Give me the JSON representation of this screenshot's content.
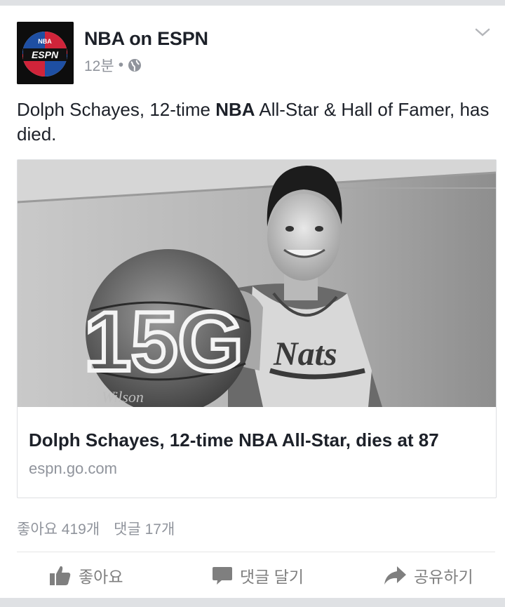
{
  "post": {
    "author": "NBA on ESPN",
    "time": "12분",
    "separator": "•",
    "text_before": "Dolph Schayes, 12-time ",
    "text_bold": "NBA",
    "text_after": " All-Star & Hall of Famer, has died."
  },
  "logo": {
    "top_text": "NBA",
    "bottom_text": "ESPN"
  },
  "link": {
    "title": "Dolph Schayes, 12-time NBA All-Star, dies at 87",
    "domain": "espn.go.com",
    "photo": {
      "ball_text": "15G",
      "jersey_text": "Nats",
      "ball_brand": "Wilson"
    }
  },
  "stats": {
    "likes": "좋아요 419개",
    "comments": "댓글 17개"
  },
  "actions": {
    "like": "좋아요",
    "comment": "댓글 달기",
    "share": "공유하기"
  },
  "colors": {
    "background": "#dfe1e4",
    "text": "#1d2129",
    "muted": "#90949c",
    "action": "#7f7f7f"
  }
}
